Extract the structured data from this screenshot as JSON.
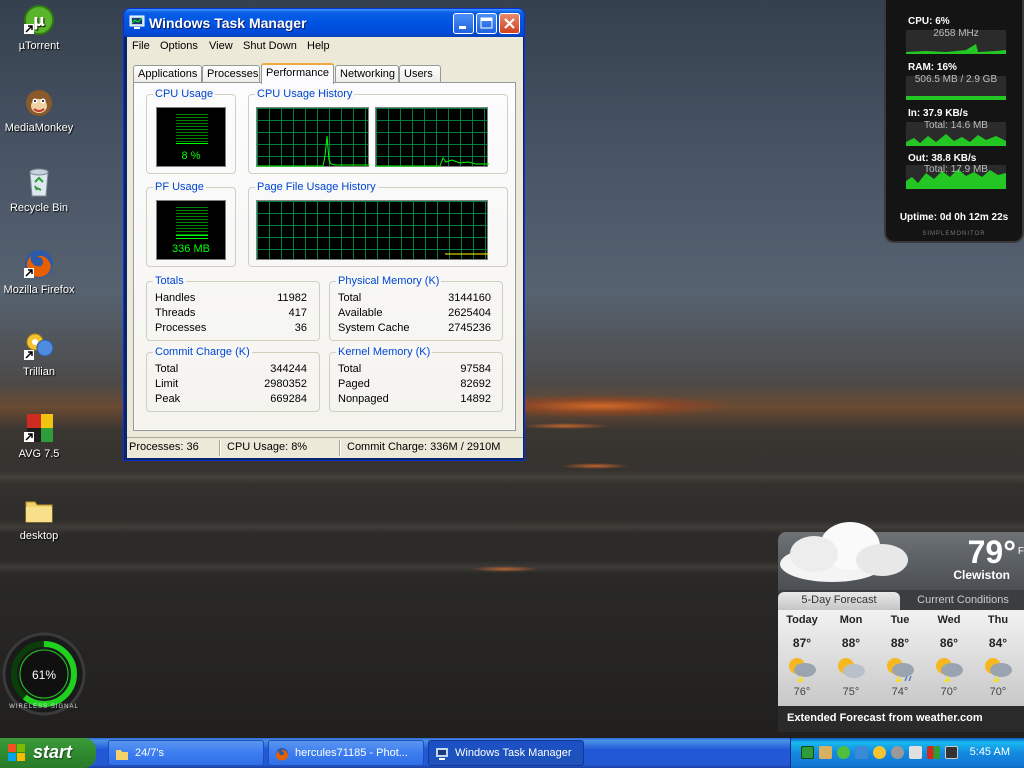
{
  "desktop": {
    "icons": [
      {
        "label": "µTorrent",
        "icon": "utorrent-icon"
      },
      {
        "label": "MediaMonkey",
        "icon": "mediamonkey-icon"
      },
      {
        "label": "Recycle Bin",
        "icon": "recycle-bin-icon"
      },
      {
        "label": "Mozilla Firefox",
        "icon": "firefox-icon"
      },
      {
        "label": "Trillian",
        "icon": "trillian-icon"
      },
      {
        "label": "AVG 7.5",
        "icon": "avg-icon"
      },
      {
        "label": "desktop",
        "icon": "folder-icon"
      }
    ]
  },
  "task_manager": {
    "title": "Windows Task Manager",
    "menu": [
      "File",
      "Options",
      "View",
      "Shut Down",
      "Help"
    ],
    "tabs": [
      "Applications",
      "Processes",
      "Performance",
      "Networking",
      "Users"
    ],
    "active_tab": "Performance",
    "cpu_usage": {
      "label": "CPU Usage",
      "value": "8 %",
      "percent": 8
    },
    "cpu_history_label": "CPU Usage History",
    "pf_usage": {
      "label": "PF Usage",
      "value": "336 MB",
      "percent": 12
    },
    "pf_history_label": "Page File Usage History",
    "totals": {
      "label": "Totals",
      "rows": [
        {
          "name": "Handles",
          "value": "11982"
        },
        {
          "name": "Threads",
          "value": "417"
        },
        {
          "name": "Processes",
          "value": "36"
        }
      ]
    },
    "physical_memory": {
      "label": "Physical Memory (K)",
      "rows": [
        {
          "name": "Total",
          "value": "3144160"
        },
        {
          "name": "Available",
          "value": "2625404"
        },
        {
          "name": "System Cache",
          "value": "2745236"
        }
      ]
    },
    "commit_charge": {
      "label": "Commit Charge (K)",
      "rows": [
        {
          "name": "Total",
          "value": "344244"
        },
        {
          "name": "Limit",
          "value": "2980352"
        },
        {
          "name": "Peak",
          "value": "669284"
        }
      ]
    },
    "kernel_memory": {
      "label": "Kernel Memory (K)",
      "rows": [
        {
          "name": "Total",
          "value": "97584"
        },
        {
          "name": "Paged",
          "value": "82692"
        },
        {
          "name": "Nonpaged",
          "value": "14892"
        }
      ]
    },
    "status": {
      "processes": "Processes: 36",
      "cpu": "CPU Usage: 8%",
      "commit": "Commit Charge: 336M / 2910M"
    }
  },
  "simple_monitor": {
    "cpu_label": "CPU: 6%",
    "cpu_sub": "2658 MHz",
    "ram_label": "RAM: 16%",
    "ram_sub": "506.5 MB / 2.9 GB",
    "in_label": "In: 37.9 KB/s",
    "in_sub": "Total: 14.6 MB",
    "out_label": "Out: 38.8 KB/s",
    "out_sub": "Total: 17.9 MB",
    "uptime": "Uptime: 0d 0h 12m 22s",
    "brand": "SIMPLEMONITOR"
  },
  "wireless": {
    "percent": "61%",
    "label": "WIRELESS SIGNAL",
    "level": 0.61
  },
  "weather": {
    "temp": "79°",
    "unit": "F",
    "city": "Clewiston",
    "tab_forecast": "5-Day Forecast",
    "tab_current": "Current Conditions",
    "days": [
      {
        "day": "Today",
        "hi": "87°",
        "lo": "76°"
      },
      {
        "day": "Mon",
        "hi": "88°",
        "lo": "75°"
      },
      {
        "day": "Tue",
        "hi": "88°",
        "lo": "74°"
      },
      {
        "day": "Wed",
        "hi": "86°",
        "lo": "70°"
      },
      {
        "day": "Thu",
        "hi": "84°",
        "lo": "70°"
      }
    ],
    "footer": "Extended Forecast from weather.com"
  },
  "taskbar": {
    "start": "start",
    "tasks": [
      {
        "label": "24/7's",
        "icon": "folder-icon"
      },
      {
        "label": "hercules71185 - Phot...",
        "icon": "firefox-icon"
      },
      {
        "label": "Windows Task Manager",
        "icon": "task-manager-icon"
      }
    ],
    "clock": "5:45 AM"
  },
  "colors": {
    "xp_blue": "#0054e3",
    "start_green": "#2f8b2f",
    "graph_green": "#00ff00",
    "groupbox_label": "#0046d5"
  }
}
